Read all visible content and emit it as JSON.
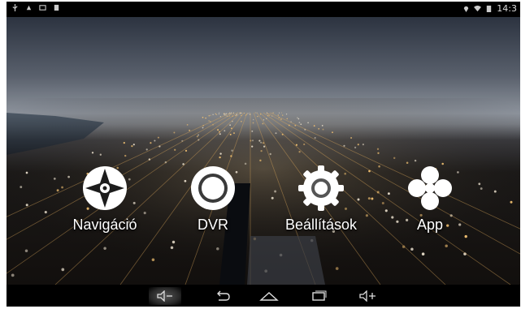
{
  "status_bar": {
    "time": "14:3",
    "left_icons": [
      "usb-icon",
      "notification-icon",
      "gallery-icon",
      "sd-card-icon"
    ],
    "right_icons": [
      "location-icon",
      "wifi-icon",
      "battery-icon"
    ]
  },
  "launcher": {
    "apps": [
      {
        "label": "Navigáció",
        "icon": "compass-icon"
      },
      {
        "label": "DVR",
        "icon": "ring-icon"
      },
      {
        "label": "Beállítások",
        "icon": "gear-icon"
      },
      {
        "label": "App",
        "icon": "four-leaf-icon"
      }
    ]
  },
  "nav_bar": {
    "buttons": [
      "volume-down-icon",
      "back-icon",
      "home-icon",
      "recent-apps-icon",
      "volume-up-icon"
    ],
    "active": "volume-down-icon"
  },
  "colors": {
    "icon": "#ffffff",
    "bar": "#000000"
  }
}
